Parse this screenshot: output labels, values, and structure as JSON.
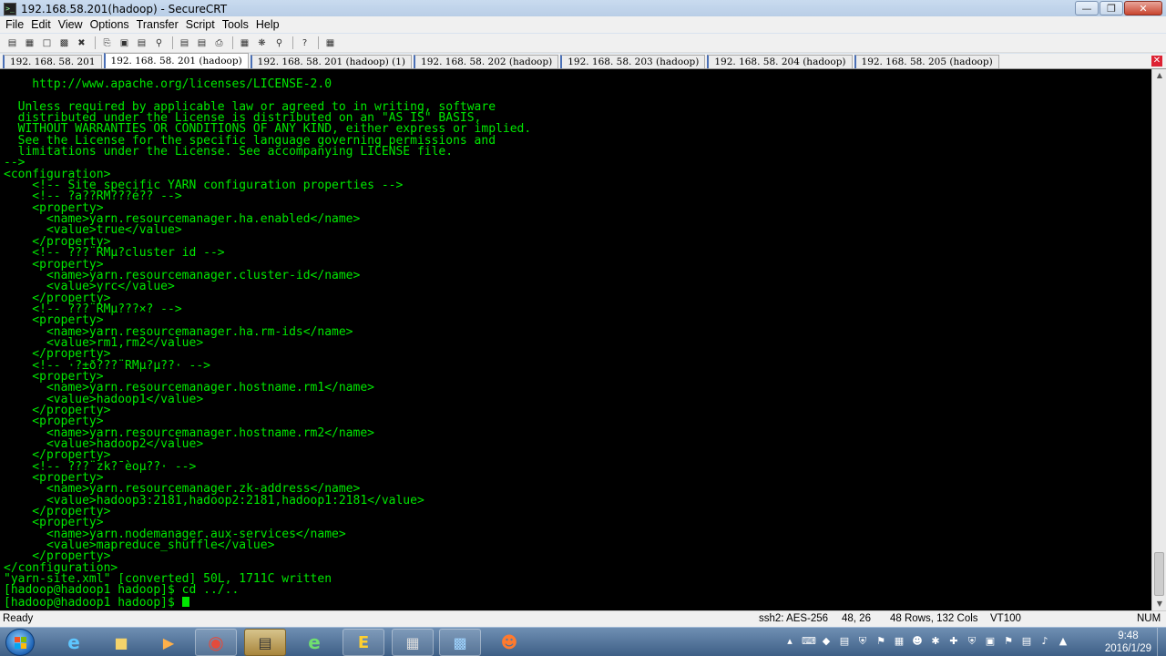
{
  "window": {
    "title": "192.168.58.201(hadoop) - SecureCRT"
  },
  "menu": [
    "File",
    "Edit",
    "View",
    "Options",
    "Transfer",
    "Script",
    "Tools",
    "Help"
  ],
  "tabs": [
    {
      "label": "192. 168. 58. 201",
      "active": false
    },
    {
      "label": "192. 168. 58. 201 (hadoop)",
      "active": true
    },
    {
      "label": "192. 168. 58. 201 (hadoop)   (1)",
      "active": false
    },
    {
      "label": "192. 168. 58. 202 (hadoop)",
      "active": false
    },
    {
      "label": "192. 168. 58. 203 (hadoop)",
      "active": false
    },
    {
      "label": "192. 168. 58. 204 (hadoop)",
      "active": false
    },
    {
      "label": "192. 168. 58. 205 (hadoop)",
      "active": false
    }
  ],
  "terminal": {
    "lines": [
      "    http://www.apache.org/licenses/LICENSE-2.0",
      "",
      "  Unless required by applicable law or agreed to in writing, software",
      "  distributed under the License is distributed on an \"AS IS\" BASIS,",
      "  WITHOUT WARRANTIES OR CONDITIONS OF ANY KIND, either express or implied.",
      "  See the License for the specific language governing permissions and",
      "  limitations under the License. See accompanying LICENSE file.",
      "-->",
      "<configuration>",
      "    <!-- Site specific YARN configuration properties -->",
      "    <!-- ?a??RM???é?? -->",
      "    <property>",
      "      <name>yarn.resourcemanager.ha.enabled</name>",
      "      <value>true</value>",
      "    </property>",
      "    <!-- ???¨RMµ?cluster id -->",
      "    <property>",
      "      <name>yarn.resourcemanager.cluster-id</name>",
      "      <value>yrc</value>",
      "    </property>",
      "    <!-- ???¨RMµ???×? -->",
      "    <property>",
      "      <name>yarn.resourcemanager.ha.rm-ids</name>",
      "      <value>rm1,rm2</value>",
      "    </property>",
      "    <!-- ·?±ð???¨RMµ?µ??· -->",
      "    <property>",
      "      <name>yarn.resourcemanager.hostname.rm1</name>",
      "      <value>hadoop1</value>",
      "    </property>",
      "    <property>",
      "      <name>yarn.resourcemanager.hostname.rm2</name>",
      "      <value>hadoop2</value>",
      "    </property>",
      "    <!-- ???¨zk?¯èoµ??· -->",
      "    <property>",
      "      <name>yarn.resourcemanager.zk-address</name>",
      "      <value>hadoop3:2181,hadoop2:2181,hadoop1:2181</value>",
      "    </property>",
      "    <property>",
      "      <name>yarn.nodemanager.aux-services</name>",
      "      <value>mapreduce_shuffle</value>",
      "    </property>",
      "</configuration>",
      "\"yarn-site.xml\" [converted] 50L, 1711C written",
      "[hadoop@hadoop1 hadoop]$ cd ../..",
      "[hadoop@hadoop1 hadoop]$ "
    ]
  },
  "status": {
    "state": "Ready",
    "cipher": "ssh2: AES-256",
    "position": "48,  26",
    "size": "48 Rows, 132 Cols",
    "emulation": "VT100",
    "numlock": "NUM"
  },
  "clock": {
    "time": "9:48",
    "date": "2016/1/29"
  },
  "colors": {
    "terminal_fg": "#00e800",
    "terminal_bg": "#000000"
  }
}
